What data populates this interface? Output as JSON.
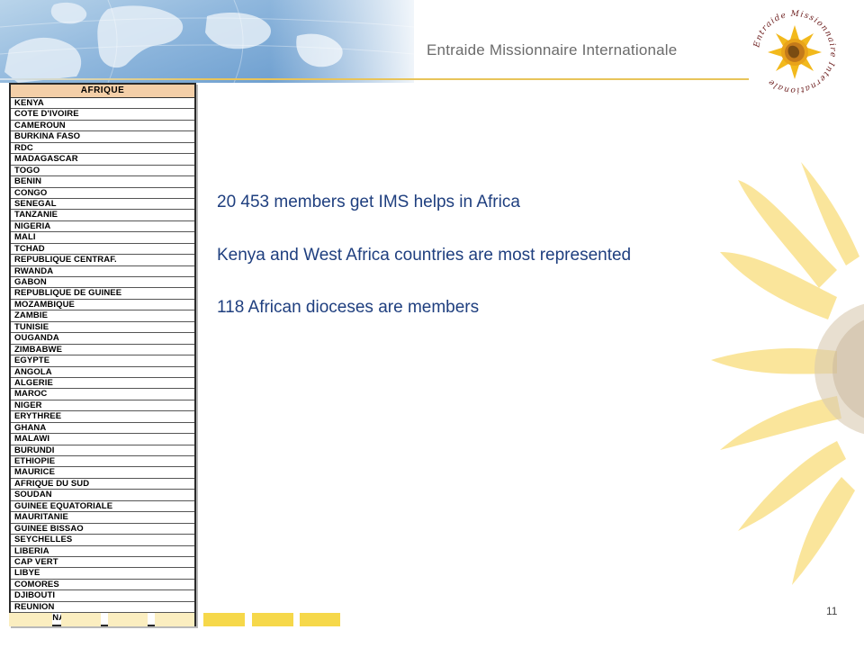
{
  "header": {
    "org_name": "Entraide Missionnaire Internationale",
    "logo_ring_text": "Entraide Missionnaire Internationale"
  },
  "table": {
    "header": "AFRIQUE",
    "countries": [
      "KENYA",
      "COTE D'IVOIRE",
      "CAMEROUN",
      "BURKINA FASO",
      "RDC",
      "MADAGASCAR",
      "TOGO",
      "BENIN",
      "CONGO",
      "SENEGAL",
      "TANZANIE",
      "NIGERIA",
      "MALI",
      "TCHAD",
      "REPUBLIQUE CENTRAF.",
      "RWANDA",
      "GABON",
      "REPUBLIQUE DE GUINEE",
      "MOZAMBIQUE",
      "ZAMBIE",
      "TUNISIE",
      "OUGANDA",
      "ZIMBABWE",
      "EGYPTE",
      "ANGOLA",
      "ALGERIE",
      "MAROC",
      "NIGER",
      "ERYTHREE",
      "GHANA",
      "MALAWI",
      "BURUNDI",
      "ETHIOPIE",
      "MAURICE",
      "AFRIQUE DU SUD",
      "SOUDAN",
      "GUINEE EQUATORIALE",
      "MAURITANIE",
      "GUINEE BISSAO",
      "SEYCHELLES",
      "LIBERIA",
      "CAP VERT",
      "LIBYE",
      "COMORES",
      "DJIBOUTI",
      "REUNION",
      "BOTSWANA"
    ]
  },
  "body": {
    "lines": [
      "20 453 members get IMS helps in Africa",
      "Kenya and West Africa countries are most represented",
      "118 African dioceses are members"
    ]
  },
  "footer": {
    "page_number": "11"
  },
  "colors": {
    "accent_gold": "#e8c45a",
    "text_blue": "#1f3f7f",
    "footer_pale": "#fbeec0",
    "footer_strong": "#f6d84a"
  }
}
